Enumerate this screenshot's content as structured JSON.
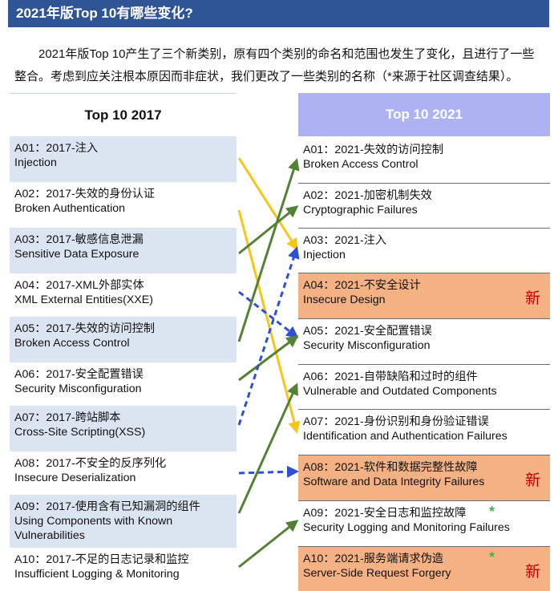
{
  "title": "2021年版Top 10有哪些变化?",
  "intro": "2021年版Top 10产生了三个新类别，原有四个类别的命名和范围也发生了变化，且进行了一些整合。考虑到应关注根本原因而非症状，我们更改了一些类别的名称（*来源于社区调查结果）。",
  "left_header": "Top 10 2017",
  "right_header": "Top 10 2021",
  "left": [
    {
      "line1": "A01：2017-注入",
      "line2": "Injection"
    },
    {
      "line1": "A02：2017-失效的身份认证",
      "line2": "Broken Authentication"
    },
    {
      "line1": "A03：2017-敏感信息泄漏",
      "line2": "Sensitive Data Exposure"
    },
    {
      "line1": "A04：2017-XML外部实体",
      "line2": "XML External Entities(XXE)"
    },
    {
      "line1": "A05：2017-失效的访问控制",
      "line2": "Broken Access Control"
    },
    {
      "line1": "A06：2017-安全配置错误",
      "line2": "Security Misconfiguration"
    },
    {
      "line1": "A07：2017-跨站脚本",
      "line2": "Cross-Site Scripting(XSS)"
    },
    {
      "line1": "A08：2017-不安全的反序列化",
      "line2": "Insecure Deserialization"
    },
    {
      "line1": "A09：2017-使用含有已知漏洞的组件",
      "line2": "Using Components with Known",
      "line3": "Vulnerabilities"
    },
    {
      "line1": "A10：2017-不足的日志记录和监控",
      "line2": "Insufficient Logging & Monitoring"
    }
  ],
  "right": [
    {
      "line1": "A01：2021-失效的访问控制",
      "line2": "Broken Access Control"
    },
    {
      "line1": "A02：2021-加密机制失效",
      "line2": "Cryptographic Failures"
    },
    {
      "line1": "A03：2021-注入",
      "line2": "Injection"
    },
    {
      "line1": "A04：2021-不安全设计",
      "line2": "Insecure Design",
      "badge": "新"
    },
    {
      "line1": "A05：2021-安全配置错误",
      "line2": "Security Misconfiguration"
    },
    {
      "line1": "A06：2021-自带缺陷和过时的组件",
      "line2": "Vulnerable and Outdated Components"
    },
    {
      "line1": "A07：2021-身份识别和身份验证错误",
      "line2": "Identification and Authentication Failures"
    },
    {
      "line1": "A08：2021-软件和数据完整性故障",
      "line2": "Software and Data Integrity Failures",
      "badge": "新"
    },
    {
      "line1": "A09：2021-安全日志和监控故障",
      "line2": "Security Logging and Monitoring Failures",
      "star": "*"
    },
    {
      "line1": "A10：2021-服务端请求伪造",
      "line2": "Server-Side Request Forgery",
      "badge": "新",
      "star": "*"
    }
  ],
  "colors": {
    "title_bg": "#2f5597",
    "left_shade": "#dbe4f1",
    "right_header_bg": "#adb3f2",
    "new_bg": "#f4b183",
    "badge_text": "#c00000",
    "arrow_yellow": "#f5c518",
    "arrow_green": "#548235",
    "arrow_blue": "#2e4fd6",
    "star": "#4caf50"
  },
  "mappings": [
    {
      "from": "A01",
      "to": "A03",
      "color": "yellow",
      "style": "solid"
    },
    {
      "from": "A02",
      "to": "A07",
      "color": "yellow",
      "style": "solid"
    },
    {
      "from": "A03",
      "to": "A02",
      "color": "green",
      "style": "solid"
    },
    {
      "from": "A04",
      "to": "A05",
      "color": "blue",
      "style": "dashed"
    },
    {
      "from": "A05",
      "to": "A01",
      "color": "green",
      "style": "solid"
    },
    {
      "from": "A06",
      "to": "A05",
      "color": "green",
      "style": "solid"
    },
    {
      "from": "A07",
      "to": "A03",
      "color": "blue",
      "style": "dashed"
    },
    {
      "from": "A08",
      "to": "A08",
      "color": "blue",
      "style": "dashed"
    },
    {
      "from": "A09",
      "to": "A06",
      "color": "green",
      "style": "solid"
    },
    {
      "from": "A10",
      "to": "A09",
      "color": "green",
      "style": "solid"
    }
  ]
}
